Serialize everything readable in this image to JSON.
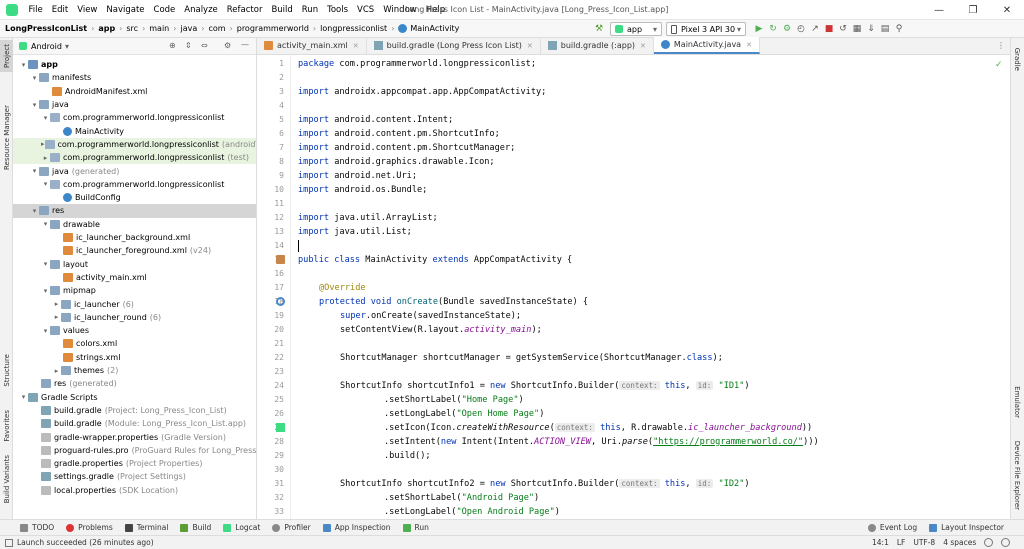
{
  "menu": [
    "File",
    "Edit",
    "View",
    "Navigate",
    "Code",
    "Analyze",
    "Refactor",
    "Build",
    "Run",
    "Tools",
    "VCS",
    "Window",
    "Help"
  ],
  "window_title": "Long Press Icon List - MainActivity.java [Long_Press_Icon_List.app]",
  "breadcrumb": [
    "LongPressIconList",
    "app",
    "src",
    "main",
    "java",
    "com",
    "programmerworld",
    "longpressiconlist",
    "MainActivity"
  ],
  "run_config": "app",
  "device": "Pixel 3 API 30",
  "project_view": "Android",
  "left_tabs": [
    "Project",
    "Resource Manager",
    "Structure",
    "Favorites",
    "Build Variants"
  ],
  "right_tabs": [
    "Gradle",
    "Emulator",
    "Device File Explorer"
  ],
  "tree": [
    {
      "label": "app",
      "extra": ""
    },
    {
      "label": "manifests",
      "extra": ""
    },
    {
      "label": "AndroidManifest.xml",
      "extra": ""
    },
    {
      "label": "java",
      "extra": ""
    },
    {
      "label": "com.programmerworld.longpressiconlist",
      "extra": ""
    },
    {
      "label": "MainActivity",
      "extra": ""
    },
    {
      "label": "com.programmerworld.longpressiconlist",
      "extra": "(androidTest)"
    },
    {
      "label": "com.programmerworld.longpressiconlist",
      "extra": "(test)"
    },
    {
      "label": "java",
      "extra": "(generated)"
    },
    {
      "label": "com.programmerworld.longpressiconlist",
      "extra": ""
    },
    {
      "label": "BuildConfig",
      "extra": ""
    },
    {
      "label": "res",
      "extra": ""
    },
    {
      "label": "drawable",
      "extra": ""
    },
    {
      "label": "ic_launcher_background.xml",
      "extra": ""
    },
    {
      "label": "ic_launcher_foreground.xml",
      "extra": "(v24)"
    },
    {
      "label": "layout",
      "extra": ""
    },
    {
      "label": "activity_main.xml",
      "extra": ""
    },
    {
      "label": "mipmap",
      "extra": ""
    },
    {
      "label": "ic_launcher",
      "extra": "(6)"
    },
    {
      "label": "ic_launcher_round",
      "extra": "(6)"
    },
    {
      "label": "values",
      "extra": ""
    },
    {
      "label": "colors.xml",
      "extra": ""
    },
    {
      "label": "strings.xml",
      "extra": ""
    },
    {
      "label": "themes",
      "extra": "(2)"
    },
    {
      "label": "res",
      "extra": "(generated)"
    },
    {
      "label": "Gradle Scripts",
      "extra": ""
    },
    {
      "label": "build.gradle",
      "extra": "(Project: Long_Press_Icon_List)"
    },
    {
      "label": "build.gradle",
      "extra": "(Module: Long_Press_Icon_List.app)"
    },
    {
      "label": "gradle-wrapper.properties",
      "extra": "(Gradle Version)"
    },
    {
      "label": "proguard-rules.pro",
      "extra": "(ProGuard Rules for Long_Press_Icon_L"
    },
    {
      "label": "gradle.properties",
      "extra": "(Project Properties)"
    },
    {
      "label": "settings.gradle",
      "extra": "(Project Settings)"
    },
    {
      "label": "local.properties",
      "extra": "(SDK Location)"
    }
  ],
  "tabs": [
    "activity_main.xml",
    "build.gradle (Long Press Icon List)",
    "build.gradle (:app)",
    "MainActivity.java"
  ],
  "line_numbers": [
    "1",
    "2",
    "3",
    "4",
    "5",
    "6",
    "7",
    "8",
    "9",
    "10",
    "11",
    "12",
    "13",
    "14",
    "15",
    "16",
    "17",
    "18",
    "19",
    "20",
    "21",
    "22",
    "23",
    "24",
    "25",
    "26",
    "27",
    "28",
    "29",
    "30",
    "31",
    "32",
    "33"
  ],
  "code": {
    "l1a": "package",
    "l1b": " com.programmerworld.longpressiconlist;",
    "l3a": "import",
    "l3b": " androidx.appcompat.app.AppCompatActivity;",
    "l5a": "import",
    "l5b": " android.content.Intent;",
    "l6a": "import",
    "l6b": " android.content.pm.ShortcutInfo;",
    "l7a": "import",
    "l7b": " android.content.pm.ShortcutManager;",
    "l8a": "import",
    "l8b": " android.graphics.drawable.Icon;",
    "l9a": "import",
    "l9b": " android.net.Uri;",
    "l10a": "import",
    "l10b": " android.os.Bundle;",
    "l12a": "import",
    "l12b": " java.util.ArrayList;",
    "l13a": "import",
    "l13b": " java.util.List;",
    "l15a": "public class",
    "l15b": " MainActivity ",
    "l15c": "extends",
    "l15d": " AppCompatActivity {",
    "l17": "@Override",
    "l18a": "protected void",
    "l18b": "onCreate",
    "l18c": "(Bundle savedInstanceState) {",
    "l19a": "super",
    "l19b": ".onCreate(savedInstanceState);",
    "l20a": "setContentView(R.layout.",
    "l20b": "activity_main",
    "l20c": ");",
    "l22a": "ShortcutManager shortcutManager = getSystemService(ShortcutManager.",
    "l22b": "class",
    "l22c": ");",
    "l24a": "ShortcutInfo shortcutInfo1 = ",
    "l24b": "new",
    "l24c": " ShortcutInfo.Builder(",
    "l24h1": "context:",
    "l24d": "this",
    "l24e": ", ",
    "l24h2": "id:",
    "l24f": "\"ID1\"",
    "l24g": ")",
    "l25a": ".setShortLabel(",
    "l25b": "\"Home Page\"",
    "l25c": ")",
    "l26a": ".setLongLabel(",
    "l26b": "\"Open Home Page\"",
    "l26c": ")",
    "l27a": ".setIcon(Icon.",
    "l27b": "createWithResource",
    "l27c": "(",
    "l27h": "context:",
    "l27d": "this",
    "l27e": ", R.drawable.",
    "l27f": "ic_launcher_background",
    "l27g": "))",
    "l28a": ".setIntent(",
    "l28b": "new",
    "l28c": " Intent(Intent.",
    "l28d": "ACTION_VIEW",
    "l28e": ", Uri.",
    "l28f": "parse",
    "l28g": "(",
    "l28i": "\"https://programmerworld.co/\"",
    "l28j": ")))",
    "l29": ".build();",
    "l31a": "ShortcutInfo shortcutInfo2 = ",
    "l31b": "new",
    "l31c": " ShortcutInfo.Builder(",
    "l31h1": "context:",
    "l31d": "this",
    "l31e": ", ",
    "l31h2": "id:",
    "l31f": "\"ID2\"",
    "l31g": ")",
    "l32a": ".setShortLabel(",
    "l32b": "\"Android Page\"",
    "l32c": ")",
    "l33a": ".setLongLabel(",
    "l33b": "\"Open Android Page\"",
    "l33c": ")"
  },
  "bottom_tools": [
    "TODO",
    "Problems",
    "Terminal",
    "Build",
    "Logcat",
    "Profiler",
    "App Inspection",
    "Run",
    "Event Log",
    "Layout Inspector"
  ],
  "status": {
    "message": "Launch succeeded (26 minutes ago)",
    "position": "14:1",
    "line_sep": "LF",
    "encoding": "UTF-8",
    "indent": "4 spaces"
  }
}
